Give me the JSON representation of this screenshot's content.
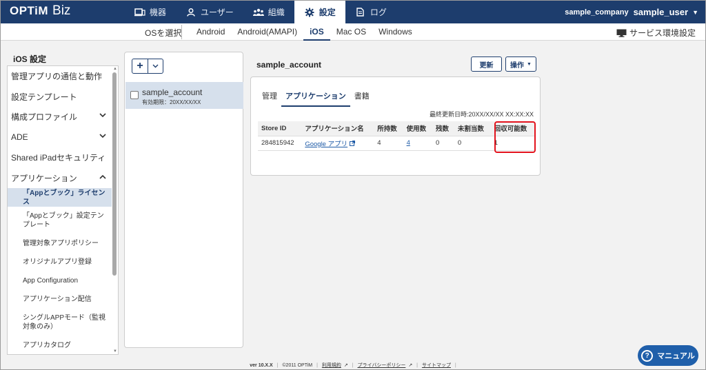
{
  "brand": {
    "name": "OPTiM",
    "product": "Biz"
  },
  "nav": {
    "devices": "機器",
    "users": "ユーザー",
    "org": "組織",
    "settings": "設定",
    "log": "ログ"
  },
  "user_area": {
    "company": "sample_company",
    "user": "sample_user"
  },
  "os_bar": {
    "select_label": "OSを選択",
    "tabs": [
      "Android",
      "Android(AMAPI)",
      "iOS",
      "Mac OS",
      "Windows"
    ],
    "active_tab": "iOS",
    "service_env": "サービス環境設定"
  },
  "sidebar": {
    "title": "iOS 設定",
    "items": [
      "管理アプリの通信と動作",
      "設定テンプレート",
      "構成プロファイル",
      "ADE",
      "Shared iPadセキュリティ",
      "アプリケーション"
    ],
    "sub_items": [
      "「Appとブック」ライセンス",
      "「Appとブック」設定テンプレート",
      "管理対象アプリポリシー",
      "オリジナルアプリ登録",
      "App Configuration",
      "アプリケーション配信",
      "シングルAPPモード（監視対象のみ）",
      "アプリカタログ"
    ]
  },
  "accounts": {
    "add_label": "+",
    "items": [
      {
        "name": "sample_account",
        "expiry": "有効期限：20XX/XX/XX"
      }
    ]
  },
  "main": {
    "title": "sample_account",
    "refresh_label": "更新",
    "ops_label": "操作",
    "tabs": [
      "管理",
      "アプリケーション",
      "書籍"
    ],
    "active_tab": "アプリケーション",
    "last_updated": "最終更新日時:20XX/XX/XX XX:XX:XX",
    "table": {
      "headers": [
        "Store ID",
        "アプリケーション名",
        "所持数",
        "使用数",
        "残数",
        "未割当数",
        "回収可能数"
      ],
      "rows": [
        {
          "store_id": "284815942",
          "app_name": "Google アプリ",
          "owned": "4",
          "used": "4",
          "remaining": "0",
          "unassigned": "0",
          "recoverable": "1"
        }
      ]
    }
  },
  "footer": {
    "version": "ver 10.X.X",
    "copyright": "©2011 OPTiM",
    "terms": "利用規約",
    "privacy": "プライバシーポリシー",
    "sitemap": "サイトマップ"
  },
  "manual_label": "マニュアル",
  "colors": {
    "navy": "#1d3d6d",
    "highlight": "#e3121c",
    "selected_bg": "#d6e0ec",
    "manual_btn": "#1f5faa"
  }
}
